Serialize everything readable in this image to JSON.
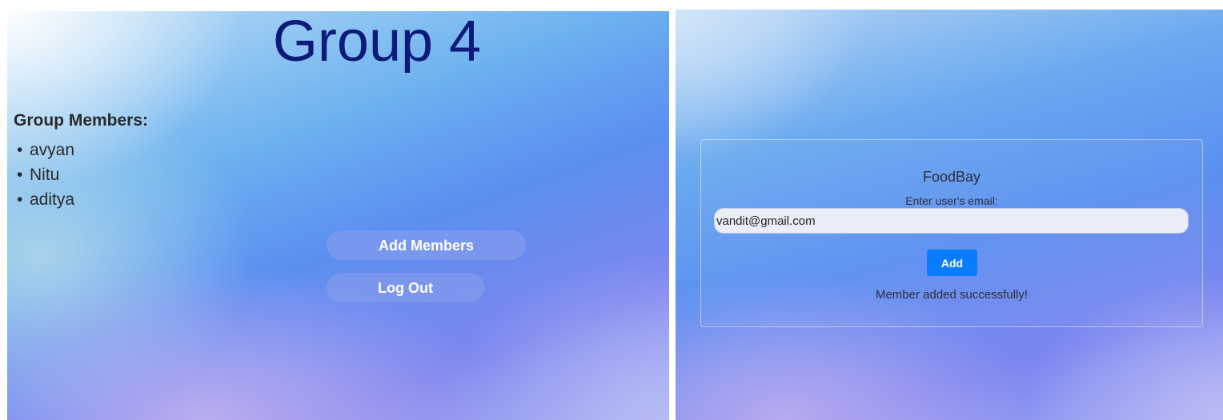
{
  "left_screen": {
    "title": "Group 4",
    "members_heading": "Group Members:",
    "members": [
      "avyan",
      "Nitu",
      "aditya"
    ],
    "bullet": "•",
    "buttons": {
      "add_members": "Add Members",
      "log_out": "Log Out"
    }
  },
  "right_screen": {
    "app_name": "FoodBay",
    "email_label": "Enter user's email:",
    "email_value": "vandit@gmail.com",
    "add_button": "Add",
    "status_message": "Member added successfully!"
  },
  "colors": {
    "title": "#0d1a7a",
    "primary_button": "#0a7cff",
    "text": "#2a2a2a"
  }
}
